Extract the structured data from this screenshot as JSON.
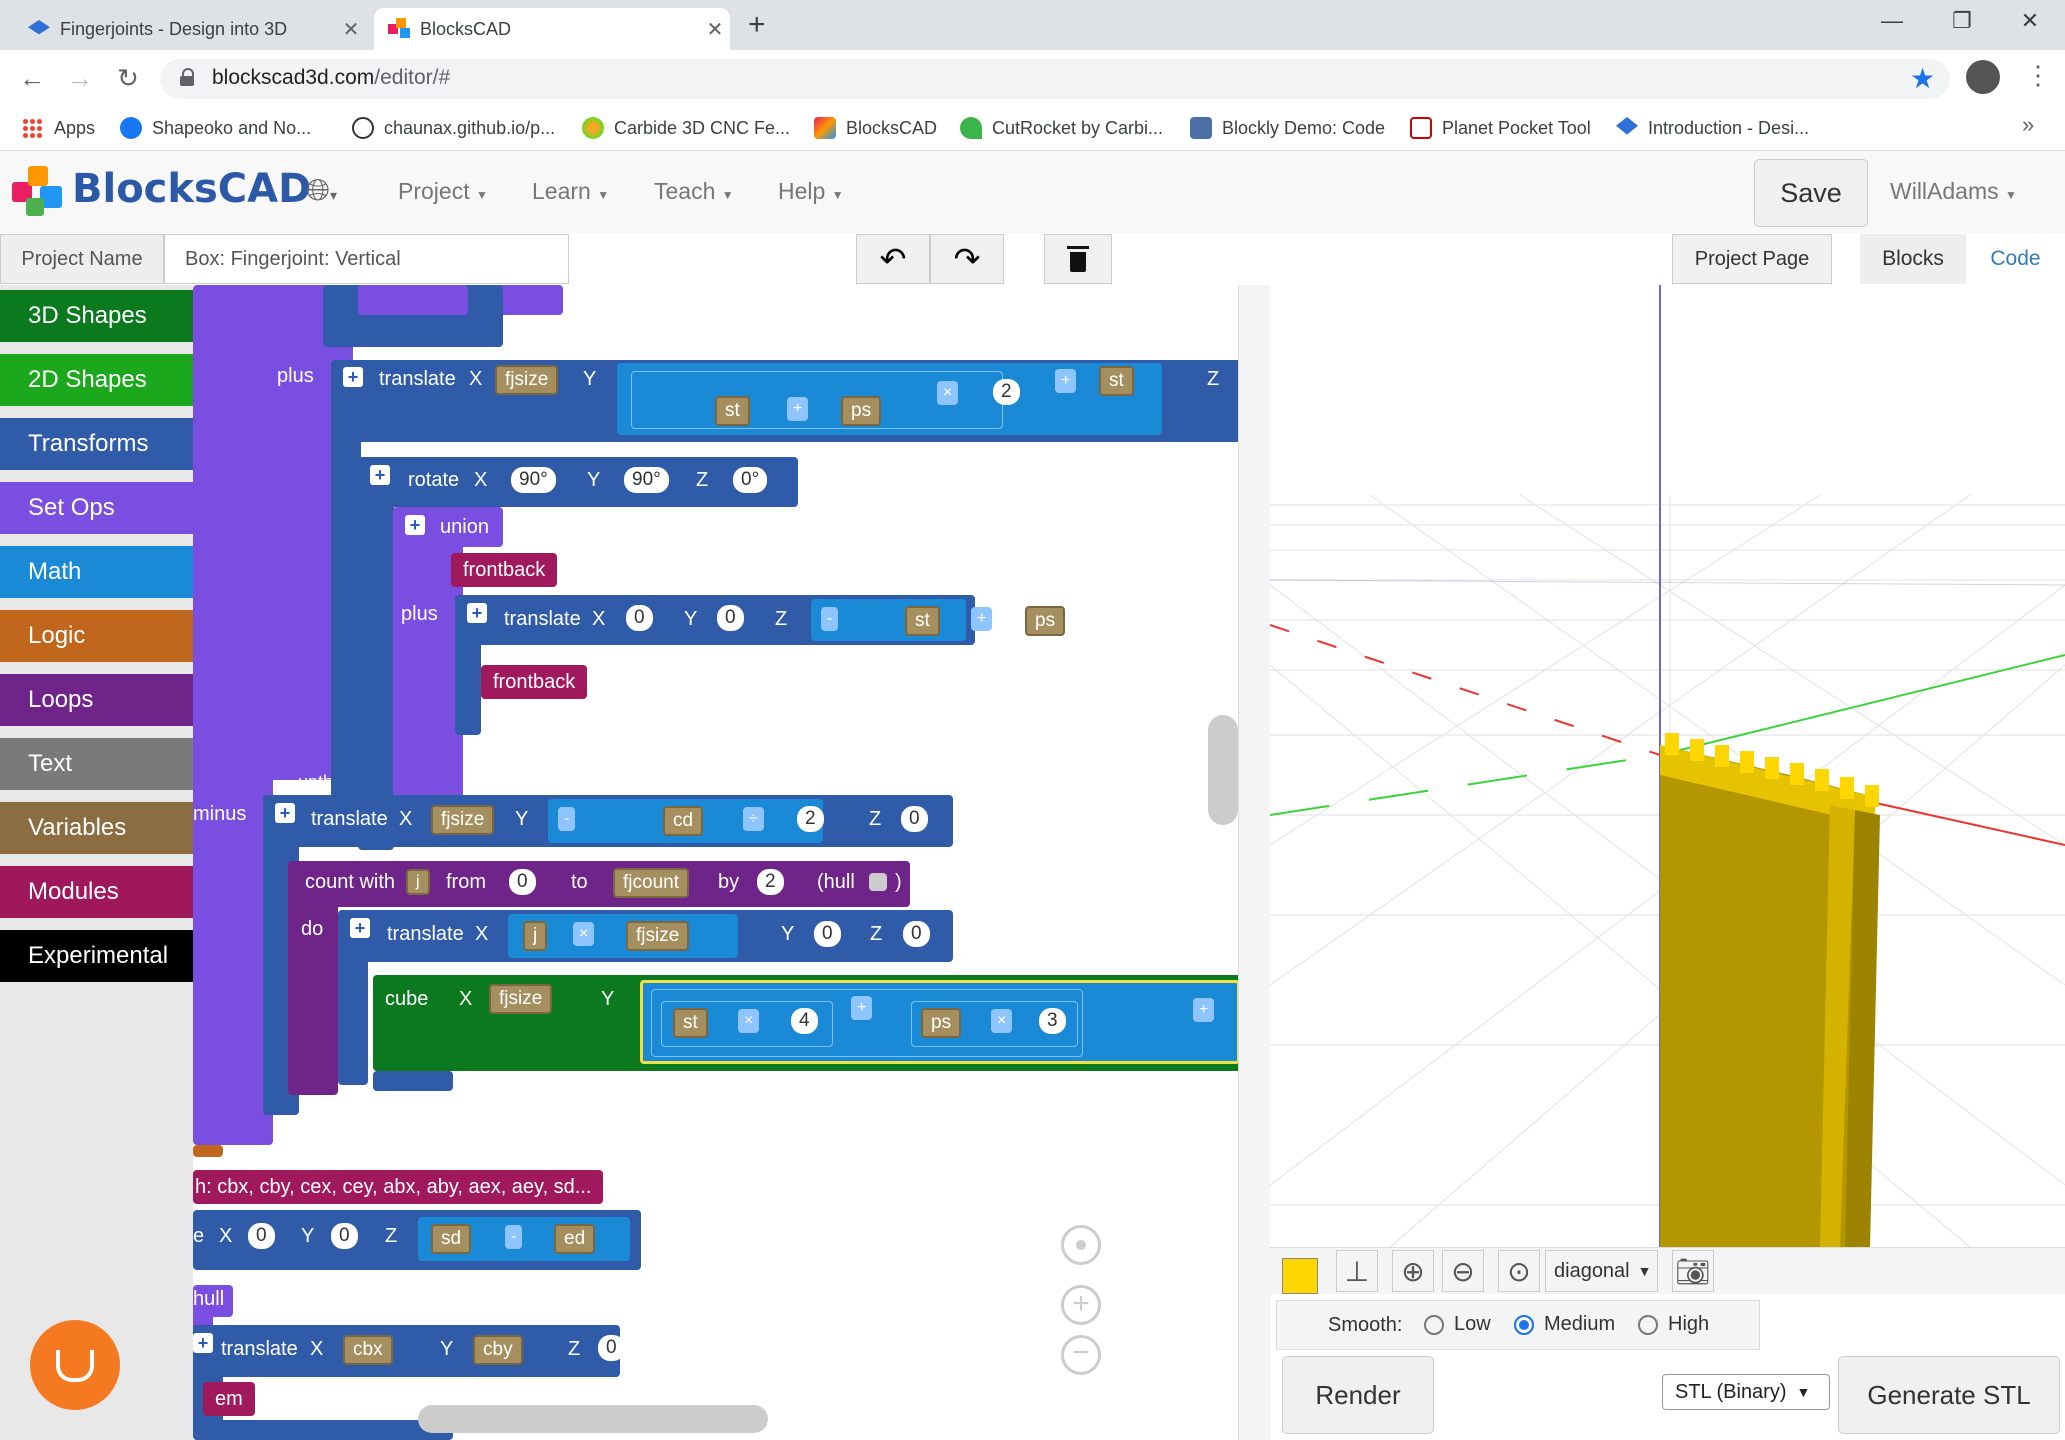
{
  "browser": {
    "tabs": [
      {
        "title": "Fingerjoints - Design into 3D",
        "active": false
      },
      {
        "title": "BlocksCAD",
        "active": true
      }
    ],
    "new_tab": "+",
    "url_host": "blockscad3d.com",
    "url_path": "/editor/#",
    "bookmarks": [
      "Apps",
      "Shapeoko and No...",
      "chaunax.github.io/p...",
      "Carbide 3D CNC Fe...",
      "BlocksCAD",
      "CutRocket by Carbi...",
      "Blockly Demo: Code",
      "Planet Pocket Tool",
      "Introduction - Desi..."
    ],
    "more": "»"
  },
  "app": {
    "logo": "BlocksCAD",
    "menus": [
      "Project",
      "Learn",
      "Teach",
      "Help"
    ],
    "save": "Save",
    "user": "WillAdams",
    "project_name_label": "Project Name",
    "project_name": "Box: Fingerjoint: Vertical",
    "project_page": "Project Page",
    "view_tabs": [
      "Blocks",
      "Code"
    ]
  },
  "toolbox": [
    {
      "label": "3D Shapes",
      "color": "#0b7a1e"
    },
    {
      "label": "2D Shapes",
      "color": "#1ba81c"
    },
    {
      "label": "Transforms",
      "color": "#2f5ba8"
    },
    {
      "label": "Set Ops",
      "color": "#7a4ee0"
    },
    {
      "label": "Math",
      "color": "#1a8ad6"
    },
    {
      "label": "Logic",
      "color": "#c0661d"
    },
    {
      "label": "Loops",
      "color": "#6f248a"
    },
    {
      "label": "Text",
      "color": "#7a7a7a"
    },
    {
      "label": "Variables",
      "color": "#8c6d42"
    },
    {
      "label": "Modules",
      "color": "#a0185c"
    },
    {
      "label": "Experimental",
      "color": "#000000"
    }
  ],
  "blocks": {
    "plus1": "plus",
    "translate1": {
      "label": "translate",
      "x": "X",
      "xv": "fjsize",
      "y": "Y",
      "zl": "Z",
      "ops": [
        "st",
        "+",
        "ps",
        "×",
        "2",
        "+",
        "st"
      ]
    },
    "rotate": {
      "label": "rotate",
      "x": "X",
      "xv": "90°",
      "y": "Y",
      "yv": "90°",
      "z": "Z",
      "zv": "0°"
    },
    "union": "union",
    "frontback1": "frontback",
    "plus2": "plus",
    "translate2": {
      "label": "translate",
      "x": "X",
      "xv": "0",
      "y": "Y",
      "yv": "0",
      "z": "Z",
      "ops": [
        "-",
        "st",
        "+",
        "ps"
      ]
    },
    "frontback2": "frontback",
    "depth_frag": "upth",
    "minus": "minus",
    "translate3": {
      "label": "translate",
      "x": "X",
      "xv": "fjsize",
      "y": "Y",
      "ops": [
        "-",
        "cd",
        "÷",
        "2"
      ],
      "z": "Z",
      "zv": "0"
    },
    "count": {
      "label": "count with",
      "var": "j",
      "from": "from",
      "fromv": "0",
      "to": "to",
      "tov": "fjcount",
      "by": "by",
      "byv": "2",
      "hull": "(hull",
      "close": ")"
    },
    "do": "do",
    "translate4": {
      "label": "translate",
      "x": "X",
      "ops": [
        "j",
        "×",
        "fjsize"
      ],
      "y": "Y",
      "yv": "0",
      "z": "Z",
      "zv": "0"
    },
    "cube": {
      "label": "cube",
      "x": "X",
      "xv": "fjsize",
      "y": "Y",
      "ops": [
        "st",
        "×",
        "4",
        "+",
        "ps",
        "×",
        "3",
        "+"
      ]
    },
    "module_call": "h: cbx, cby, cex, cey, abx, aby, aex, aey, sd...",
    "translate5": {
      "label": "e",
      "x": "X",
      "xv": "0",
      "y": "Y",
      "yv": "0",
      "z": "Z",
      "ops": [
        "sd",
        "-",
        "ed"
      ]
    },
    "hull": "hull",
    "translate6": {
      "label": "translate",
      "x": "X",
      "xv": "cbx",
      "y": "Y",
      "yv": "cby",
      "z": "Z",
      "zv": "0"
    },
    "em": "em"
  },
  "viewer": {
    "view": "diagonal",
    "smooth_label": "Smooth:",
    "smooth_options": [
      "Low",
      "Medium",
      "High"
    ],
    "smooth_selected": "Medium",
    "render": "Render",
    "format": "STL (Binary)",
    "generate": "Generate STL",
    "object_color": "#ffd700"
  }
}
